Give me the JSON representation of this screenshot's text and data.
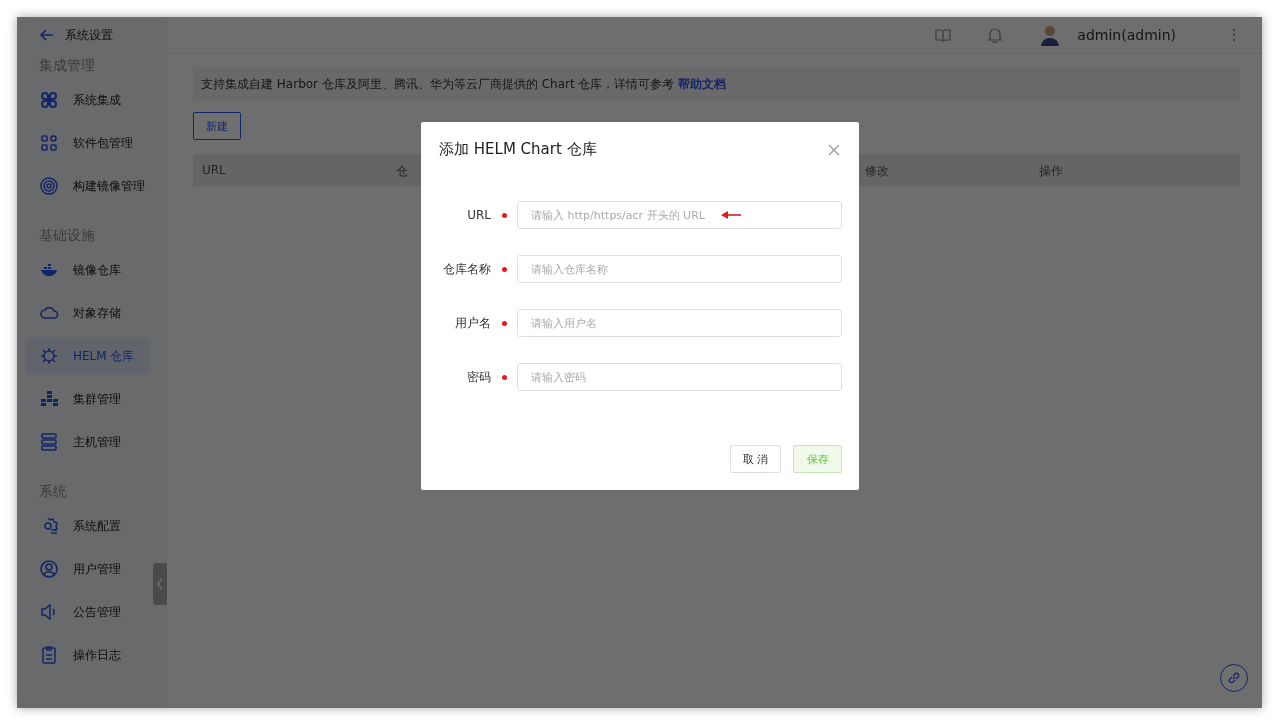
{
  "sidebar": {
    "back_title": "系统设置",
    "sections": [
      {
        "title": "集成管理",
        "items": [
          {
            "label": "系统集成",
            "selected": false
          },
          {
            "label": "软件包管理",
            "selected": false
          },
          {
            "label": "构建镜像管理",
            "selected": false
          }
        ]
      },
      {
        "title": "基础设施",
        "items": [
          {
            "label": "镜像仓库",
            "selected": false
          },
          {
            "label": "对象存储",
            "selected": false
          },
          {
            "label": "HELM 仓库",
            "selected": true
          },
          {
            "label": "集群管理",
            "selected": false
          },
          {
            "label": "主机管理",
            "selected": false
          }
        ]
      },
      {
        "title": "系统",
        "items": [
          {
            "label": "系统配置",
            "selected": false
          },
          {
            "label": "用户管理",
            "selected": false
          },
          {
            "label": "公告管理",
            "selected": false
          },
          {
            "label": "操作日志",
            "selected": false
          }
        ]
      }
    ]
  },
  "topbar": {
    "user": "admin(admin)"
  },
  "notice": {
    "text": "支持集成自建 Harbor 仓库及阿里、腾讯、华为等云厂商提供的 Chart 仓库，详情可参考",
    "link": "帮助文档"
  },
  "new_button": "新建",
  "table": {
    "columns": [
      "URL",
      "仓",
      "修改",
      "操作"
    ]
  },
  "dialog": {
    "title": "添加 HELM Chart 仓库",
    "fields": [
      {
        "label": "URL",
        "required": true,
        "placeholder": "请输入 http/https/acr 开头的 URL",
        "annotated": true
      },
      {
        "label": "仓库名称",
        "required": true,
        "placeholder": "请输入仓库名称",
        "annotated": false
      },
      {
        "label": "用户名",
        "required": true,
        "placeholder": "请输入用户名",
        "annotated": false
      },
      {
        "label": "密码",
        "required": true,
        "placeholder": "请输入密码",
        "annotated": false
      }
    ],
    "buttons": [
      {
        "label": "取 消",
        "kind": "cancel"
      },
      {
        "label": "保存",
        "kind": "save"
      }
    ]
  }
}
